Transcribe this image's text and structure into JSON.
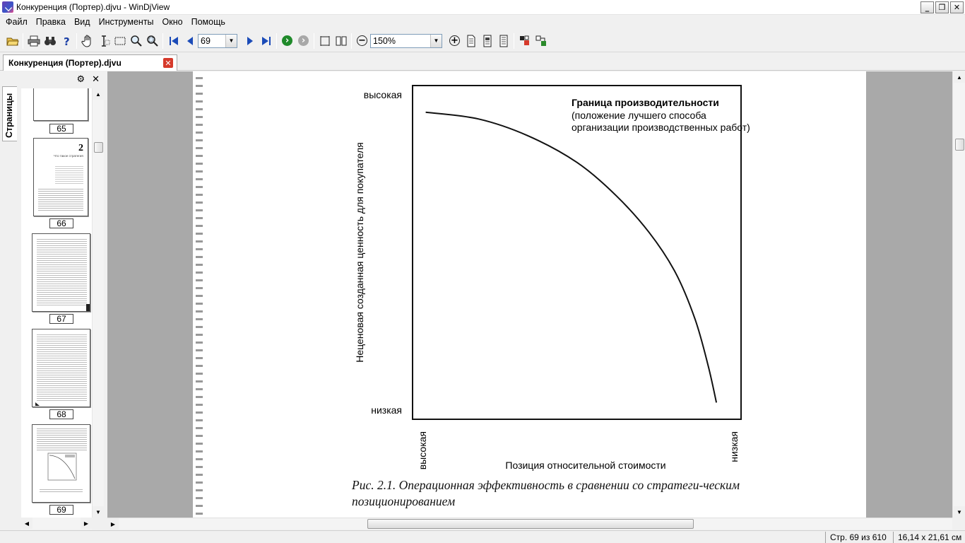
{
  "window": {
    "title": "Конкуренция (Портер).djvu - WinDjView",
    "minimize_glyph": "_",
    "restore_glyph": "❐",
    "close_glyph": "✕"
  },
  "menu": [
    "Файл",
    "Правка",
    "Вид",
    "Инструменты",
    "Окно",
    "Помощь"
  ],
  "toolbar": {
    "page_value": "69",
    "zoom_value": "150%"
  },
  "tab": {
    "label": "Конкуренция (Портер).djvu"
  },
  "sidebar": {
    "tab_label": "Страницы",
    "thumbnails": [
      {
        "page": "65"
      },
      {
        "page": "66",
        "chapter_number": "2",
        "chapter_title": "Что такое стратегия"
      },
      {
        "page": "67"
      },
      {
        "page": "68"
      },
      {
        "page": "69"
      }
    ]
  },
  "document": {
    "caption": "Рис. 2.1. Операционная эффективность в сравнении со стратеги-ческим позиционированием"
  },
  "chart_data": {
    "type": "line",
    "ylabel": "Неценовая созданная ценность для покупателя",
    "xlabel": "Позиция относительной стоимости",
    "y_tick_labels": [
      "высокая",
      "низкая"
    ],
    "x_tick_labels": [
      "высокая",
      "низкая"
    ],
    "annotation_title": "Граница производительности",
    "annotation_line1": "(положение лучшего способа",
    "annotation_line2": "организации производственных работ)",
    "xlim": [
      0,
      1
    ],
    "ylim": [
      0,
      1
    ],
    "series": [
      {
        "points": [
          [
            0.04,
            0.92
          ],
          [
            0.2,
            0.9
          ],
          [
            0.35,
            0.85
          ],
          [
            0.5,
            0.77
          ],
          [
            0.62,
            0.67
          ],
          [
            0.72,
            0.56
          ],
          [
            0.8,
            0.44
          ],
          [
            0.86,
            0.3
          ],
          [
            0.9,
            0.16
          ],
          [
            0.925,
            0.05
          ]
        ]
      }
    ]
  },
  "status": {
    "page_info": "Стр. 69 из 610",
    "page_size": "16,14 x 21,61 см"
  }
}
